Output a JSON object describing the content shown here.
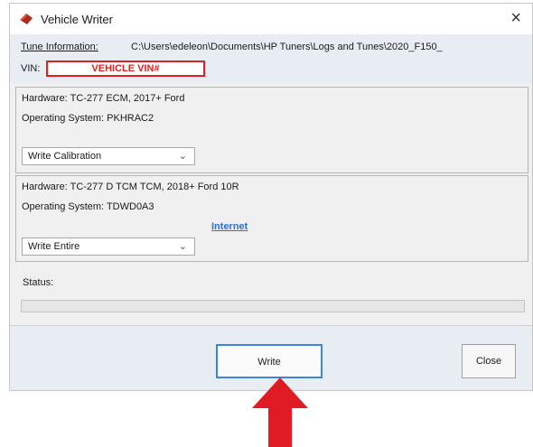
{
  "window": {
    "title": "Vehicle Writer",
    "close_glyph": "×"
  },
  "info": {
    "tune_label": "Tune Information:",
    "tune_path": "C:\\Users\\edeleon\\Documents\\HP Tuners\\Logs and Tunes\\2020_F150_",
    "vin_label": "VIN:",
    "vin_value": "VEHICLE VIN#"
  },
  "modules": [
    {
      "hardware": "Hardware: TC-277 ECM, 2017+ Ford",
      "os": "Operating System: PKHRAC2",
      "write_mode": "Write Calibration"
    },
    {
      "hardware": "Hardware: TC-277 D TCM TCM, 2018+ Ford 10R",
      "os": "Operating System: TDWD0A3",
      "write_mode": "Write Entire",
      "link": "Internet"
    }
  ],
  "status": {
    "label": "Status:",
    "progress": 0
  },
  "buttons": {
    "write": "Write",
    "close": "Close"
  },
  "colors": {
    "highlight": "#e02020",
    "link": "#2b6fd6",
    "focus": "#3b86d8"
  }
}
